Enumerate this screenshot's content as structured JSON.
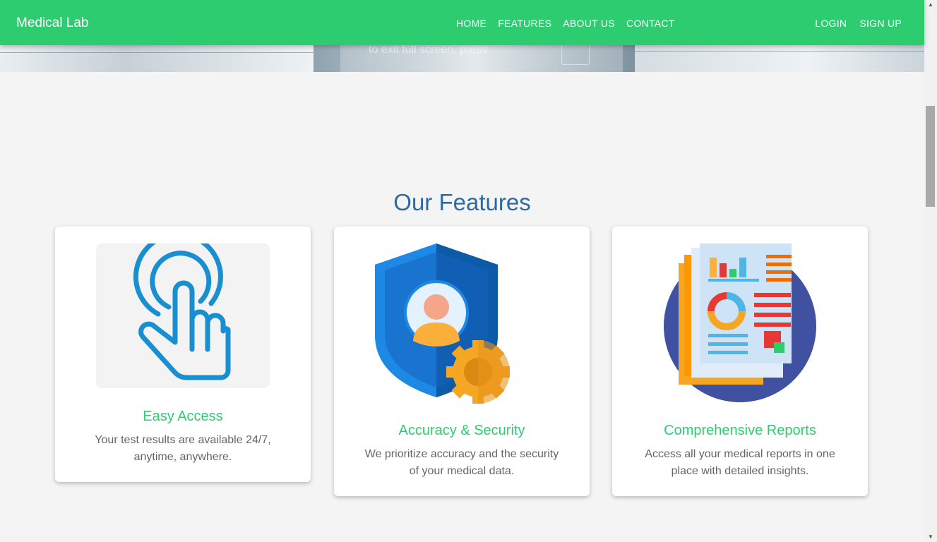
{
  "navbar": {
    "brand": "Medical Lab",
    "links": [
      "HOME",
      "FEATURES",
      "ABOUT US",
      "CONTACT"
    ],
    "auth": [
      "LOGIN",
      "SIGN UP"
    ],
    "color": "#2ecc71"
  },
  "hero": {
    "ghost_text": "to exit full screen, press"
  },
  "features": {
    "title": "Our Features",
    "cards": [
      {
        "icon": "tap-hand-icon",
        "title": "Easy Access",
        "desc": "Your test results are available 24/7, anytime, anywhere."
      },
      {
        "icon": "shield-user-gear-icon",
        "title": "Accuracy & Security",
        "desc": "We prioritize accuracy and the security of your medical data."
      },
      {
        "icon": "report-documents-icon",
        "title": "Comprehensive Reports",
        "desc": "Access all your medical reports in one place with detailed insights."
      }
    ]
  },
  "colors": {
    "accent": "#2ecc71",
    "title": "#2b6aa5",
    "text": "#666666"
  }
}
